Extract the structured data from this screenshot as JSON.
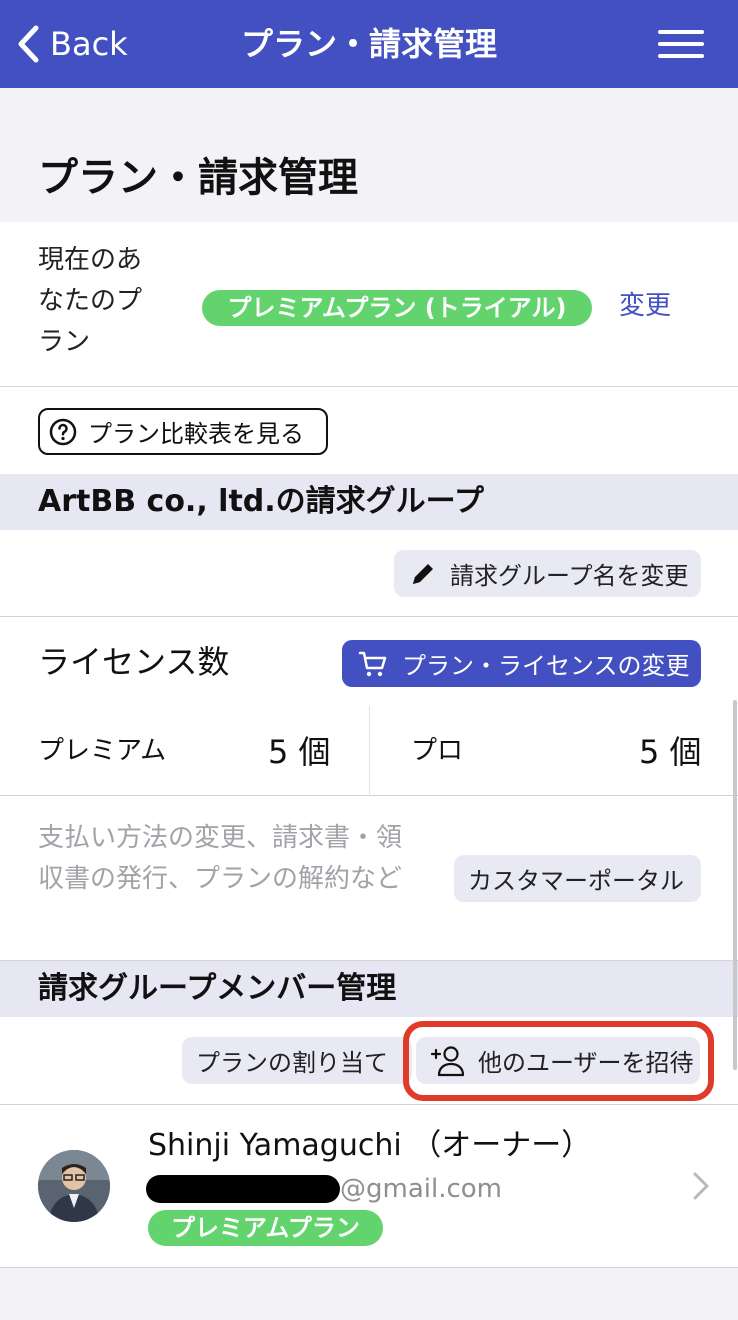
{
  "nav": {
    "back_label": "Back",
    "title": "プラン・請求管理",
    "bg_color": "#4250c2"
  },
  "page": {
    "title": "プラン・請求管理"
  },
  "current_plan": {
    "label": "現在のあなたのプラン",
    "plan_badge": "プレミアムプラン (トライアル)",
    "change_link": "変更"
  },
  "compare_button": {
    "label": "プラン比較表を見る",
    "icon": "question-circle-icon"
  },
  "billing_group": {
    "header": "ArtBB co., ltd.の請求グループ",
    "rename_button": "請求グループ名を変更",
    "rename_icon": "pencil-icon"
  },
  "licenses": {
    "label": "ライセンス数",
    "change_button": "プラン・ライセンスの変更",
    "change_icon": "cart-icon",
    "items": [
      {
        "name": "プレミアム",
        "count": "5 個"
      },
      {
        "name": "プロ",
        "count": "5 個"
      }
    ]
  },
  "portal": {
    "description": "支払い方法の変更、請求書・領収書の発行、プランの解約など",
    "button": "カスタマーポータル"
  },
  "members": {
    "header": "請求グループメンバー管理",
    "assign_button": "プランの割り当て",
    "invite_button": "他のユーザーを招待",
    "invite_icon": "add-user-icon",
    "list": [
      {
        "name": "Shinji Yamaguchi （オーナー）",
        "email_suffix": "@gmail.com",
        "plan": "プレミアムプラン"
      }
    ]
  },
  "colors": {
    "accent": "#4250c2",
    "badge_green": "#62d36d",
    "highlight_red": "#e03a2a",
    "group_header_bg": "#e6e7f3"
  }
}
